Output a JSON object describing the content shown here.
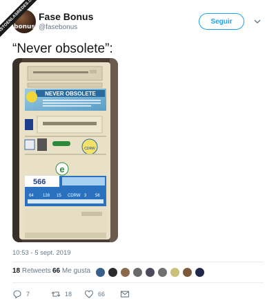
{
  "watermark": "VISTOENLASREDES.COM",
  "account": {
    "name": "Fase Bonus",
    "handle": "@fasebonus",
    "avatar_text": "bonus"
  },
  "follow_label": "Seguir",
  "tweet_text": "“Never obsolete”:",
  "photo_text": {
    "banner": "NEVER OBSOLETE",
    "model": "566",
    "cdrw": "CDRW",
    "e_label": "e",
    "specs": [
      "64",
      "128",
      "15",
      "CDRW",
      "3",
      "56"
    ]
  },
  "timestamp": "10:53 - 5 sept. 2019",
  "stats": {
    "retweets_count": "18",
    "retweets_label": "Retweets",
    "likes_count": "66",
    "likes_label": "Me gusta"
  },
  "actions": {
    "reply_count": "7",
    "retweet_count": "18",
    "like_count": "66"
  },
  "colors": {
    "accent": "#1da1f2",
    "muted": "#657786",
    "text": "#14171a"
  }
}
